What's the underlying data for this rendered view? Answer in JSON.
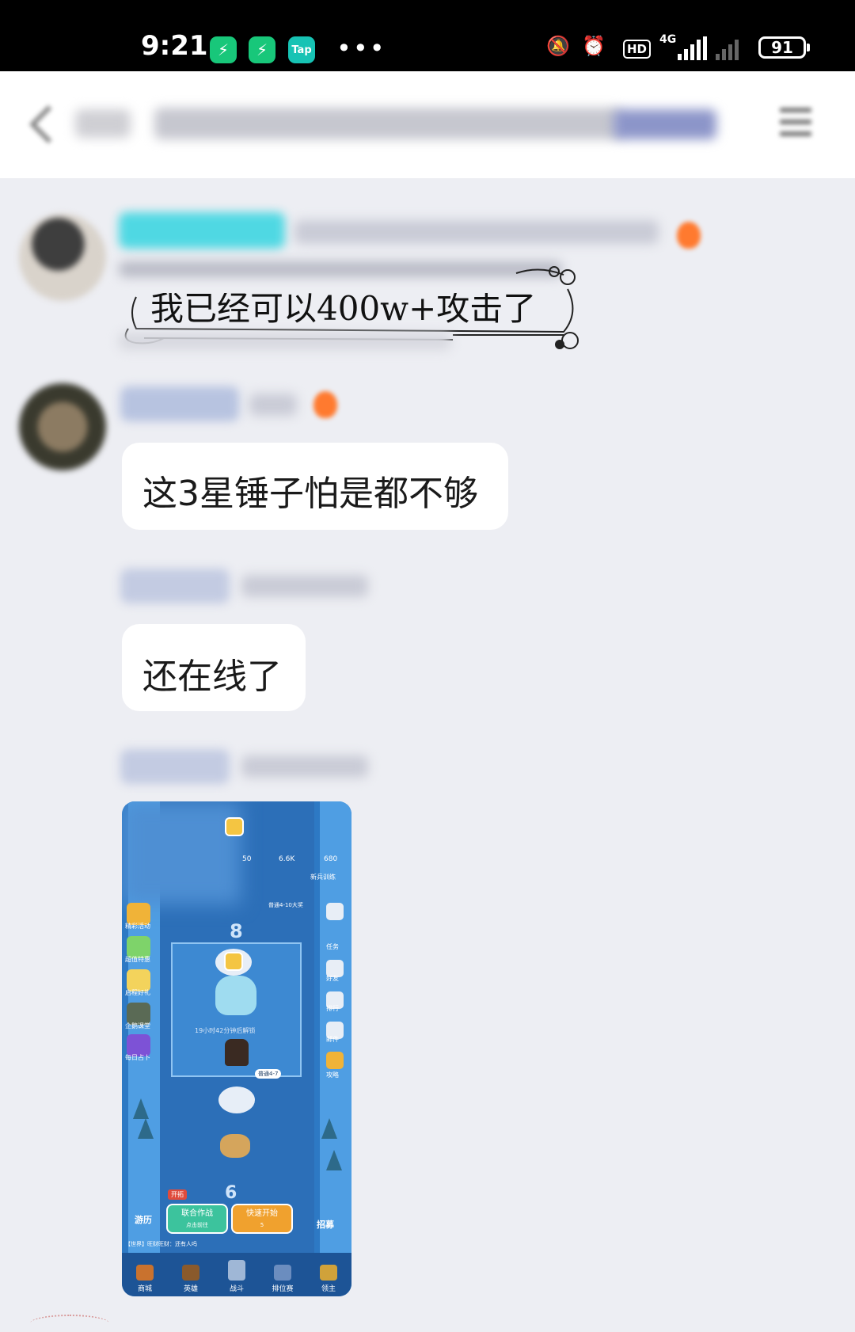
{
  "status_bar": {
    "time": "9:21",
    "app_icons": [
      "shield-icon",
      "shield-icon",
      "Tap"
    ],
    "dots": "•••",
    "network": "4G",
    "hd": "HD",
    "battery": "91"
  },
  "messages": [
    {
      "type": "decorated_text",
      "text": "我已经可以400w+攻击了"
    },
    {
      "type": "text",
      "text": "这3星锤子怕是都不够"
    },
    {
      "type": "text",
      "text": "还在线了"
    },
    {
      "type": "image"
    }
  ],
  "game_screenshot": {
    "resources": [
      "50",
      "6.6K",
      "680"
    ],
    "stage_number": "8",
    "stage_number_bottom": "6",
    "unlock_text": "19小时42分钟后解锁",
    "stage_tag": "普通4-7",
    "fire_tag": "普通4-10大奖",
    "left_menu": [
      "精彩活动",
      "超值特惠",
      "启程好礼",
      "企鹅课堂",
      "每日占卜"
    ],
    "right_menu": [
      "任务",
      "好友",
      "排行",
      "邮件",
      "攻略"
    ],
    "right_top_label": "新兵训练",
    "bottom_left_label": "游历",
    "bottom_right_label": "招募",
    "open_tag": "开拓",
    "coop_button": {
      "label": "联合作战",
      "sub": "点击前往"
    },
    "quick_button": {
      "label": "快速开始",
      "sub": "5"
    },
    "chat_line": "【世界】旺财旺财：还有人吗",
    "nav": [
      "商城",
      "英雄",
      "战斗",
      "排位赛",
      "领主"
    ]
  }
}
